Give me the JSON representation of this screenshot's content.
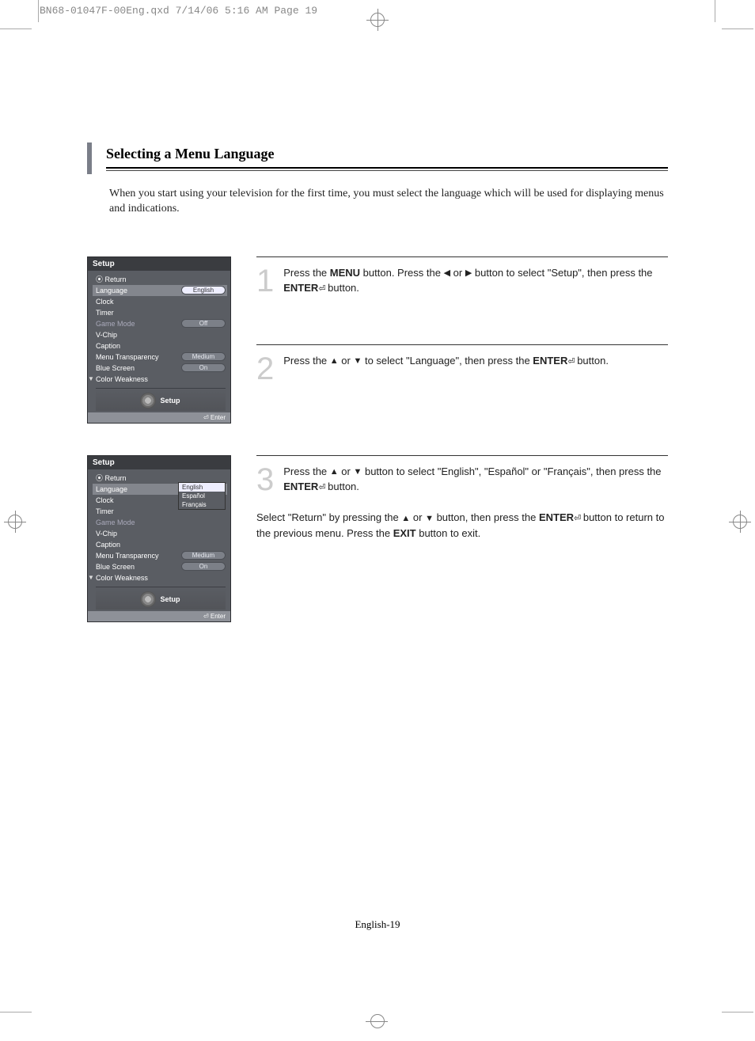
{
  "header": "BN68-01047F-00Eng.qxd  7/14/06  5:16 AM  Page 19",
  "title": "Selecting a Menu Language",
  "intro": "When you start using your television for the first time, you must select the language which will be used for displaying menus and indications.",
  "steps": {
    "s1": {
      "num": "1",
      "pre": "Press the ",
      "menu": "MENU",
      "mid1": " button. Press the ",
      "mid2": " or ",
      "mid3": " button to select \"Setup\", then press the ",
      "enter": "ENTER",
      "tail": " button."
    },
    "s2": {
      "num": "2",
      "pre": "Press the ",
      "mid2": " or ",
      "mid3": " to select \"Language\", then press the ",
      "enter": "ENTER",
      "tail": " button."
    },
    "s3": {
      "num": "3",
      "pre": "Press the ",
      "mid2": " or ",
      "mid3": " button to select \"English\", \"Español\" or \"Français\", then press the ",
      "enter": "ENTER",
      "tail": " button.",
      "ret1": "Select \"Return\" by pressing the ",
      "ret2": " or ",
      "ret3": " button, then press the ",
      "ret4": " button to return to the previous menu. Press the ",
      "exit": "EXIT",
      "ret5": " button to exit."
    }
  },
  "osd": {
    "title": "Setup",
    "return": "Return",
    "language": "Language",
    "english": "English",
    "clock": "Clock",
    "timer": "Timer",
    "game_mode": "Game Mode",
    "off": "Off",
    "vchip": "V-Chip",
    "caption": "Caption",
    "menu_trans": "Menu Transparency",
    "medium": "Medium",
    "blue_screen": "Blue Screen",
    "on": "On",
    "color_weak": "Color Weakness",
    "setup_label": "Setup",
    "enter_label": "Enter",
    "espanol": "Español",
    "francais": "Français"
  },
  "page_num": "English-19"
}
